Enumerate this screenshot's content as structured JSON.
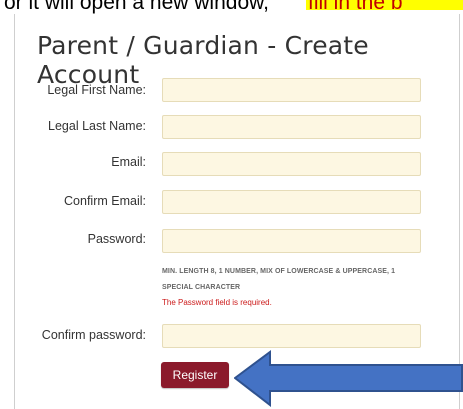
{
  "top_text": {
    "plain": "or it will open a new window,",
    "highlighted": "fill in the b"
  },
  "form": {
    "title": "Parent / Guardian - Create Account",
    "fields": [
      {
        "label": "Legal First Name:",
        "value": ""
      },
      {
        "label": "Legal Last Name:",
        "value": ""
      },
      {
        "label": "Email:",
        "value": ""
      },
      {
        "label": "Confirm Email:",
        "value": ""
      },
      {
        "label": "Password:",
        "value": ""
      },
      {
        "label": "Confirm password:",
        "value": ""
      }
    ],
    "password_hint_line1": "MIN. LENGTH 8, 1 NUMBER, MIX OF LOWERCASE & UPPERCASE, 1",
    "password_hint_line2": "SPECIAL CHARACTER",
    "password_error": "The Password field is required.",
    "register_label": "Register"
  },
  "colors": {
    "register_button": "#8b1a2b",
    "field_background": "#fdf7e2",
    "error_text": "#cc1b1b",
    "arrow_fill": "#4472c4",
    "highlight": "#ffff00"
  },
  "icons": {
    "pointer": "left-arrow-icon"
  }
}
